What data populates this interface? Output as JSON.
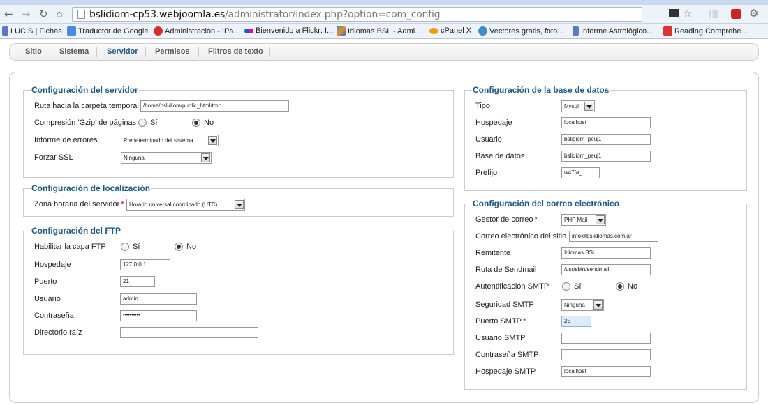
{
  "browser": {
    "url_host": "bslidiom-cp53.webjoomla.es",
    "url_path": "/administrator/index.php?option=com_config",
    "bookmarks": [
      "LUCIS | Fichas",
      "Traductor de Google",
      "Administración - IPa...",
      "Bienvenido a Flickr: I...",
      "Idiomas BSL - Admi...",
      "cPanel X",
      "Vectores gratis, foto...",
      "Informe Astrológico...",
      "Reading Comprehe..."
    ]
  },
  "submenu": {
    "items": [
      "Sitio",
      "Sistema",
      "Servidor",
      "Permisos",
      "Filtros de texto"
    ],
    "active": "Servidor"
  },
  "server": {
    "legend": "Configuración del servidor",
    "tmp_path_label": "Ruta hacia la carpeta temporal",
    "tmp_path_value": "/home/bslidiom/public_html/tmp",
    "gzip_label": "Compresión 'Gzip' de páginas",
    "yes": "Sí",
    "no": "No",
    "error_label": "Informe de errores",
    "error_value": "Predeterminado del sistema",
    "ssl_label": "Forzar SSL",
    "ssl_value": "Ninguna"
  },
  "locale": {
    "legend": "Configuración de localización",
    "tz_label": "Zona horaria del servidor",
    "req": "*",
    "tz_value": "Horario universal coordinado (UTC)"
  },
  "ftp": {
    "legend": "Configuración del FTP",
    "enable_label": "Habilitar la capa FTP",
    "yes": "Sí",
    "no": "No",
    "host_label": "Hospedaje",
    "host_value": "127.0.0.1",
    "port_label": "Puerto",
    "port_value": "21",
    "user_label": "Usuario",
    "user_value": "admin",
    "pass_label": "Contraseña",
    "pass_value": "••••••••••",
    "root_label": "Directorio raíz",
    "root_value": ""
  },
  "database": {
    "legend": "Configuración de la base de datos",
    "type_label": "Tipo",
    "type_value": "Mysql",
    "host_label": "Hospedaje",
    "host_value": "localhost",
    "user_label": "Usuario",
    "user_value": "bslidiom_peuj1",
    "db_label": "Base de datos",
    "db_value": "bslidiom_peuj1",
    "prefix_label": "Prefijo",
    "prefix_value": "w47fa_"
  },
  "mail": {
    "legend": "Configuración del correo electrónico",
    "mailer_label": "Gestor de correo",
    "req": "*",
    "mailer_value": "PHP Mail",
    "email_label": "Correo electrónico del sitio",
    "email_value": "info@bslidiomas.com.ar",
    "from_label": "Remitente",
    "from_value": "Idiomas BSL",
    "sendmail_label": "Ruta de Sendmail",
    "sendmail_value": "/usr/sbin/sendmail",
    "smtpauth_label": "Autentificación SMTP",
    "yes": "Sí",
    "no": "No",
    "smtpsecure_label": "Seguridad SMTP",
    "smtpsecure_value": "Ninguna",
    "smtpport_label": "Puerto SMTP",
    "smtpport_value": "25",
    "smtpuser_label": "Usuario SMTP",
    "smtpuser_value": "",
    "smtppass_label": "Contraseña SMTP",
    "smtppass_value": "",
    "smtphost_label": "Hospedaje SMTP",
    "smtphost_value": "localhost"
  }
}
